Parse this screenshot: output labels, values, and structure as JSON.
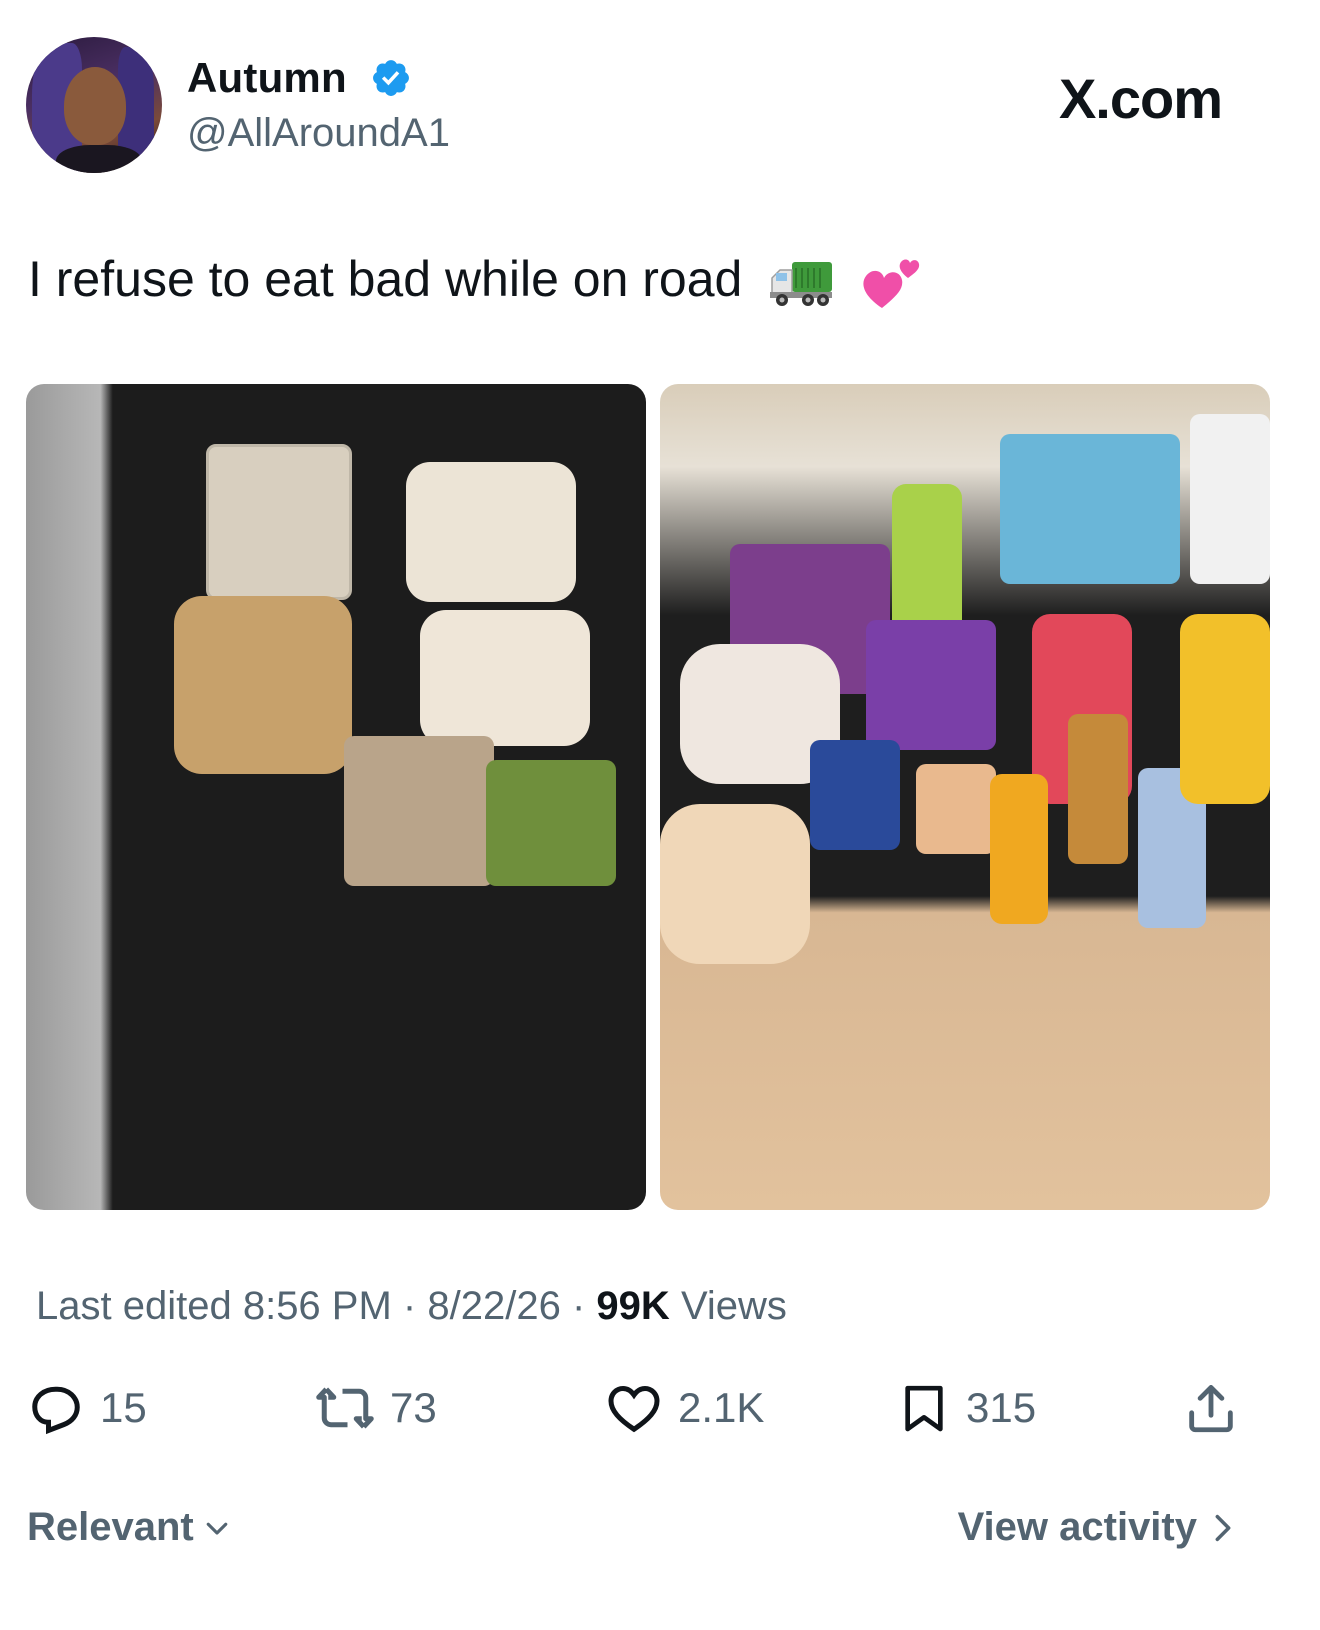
{
  "author": {
    "display_name": "Autumn",
    "handle": "@AllAroundA1",
    "verified": true
  },
  "brand": "X.com",
  "post": {
    "text": "I refuse to eat bad while on road",
    "emojis": [
      "delivery-truck-emoji",
      "revolving-hearts-emoji"
    ]
  },
  "media": [
    {
      "description": "groceries-on-checkout-belt"
    },
    {
      "description": "drinks-and-snacks-on-counter"
    }
  ],
  "meta": {
    "edited_label": "Last edited",
    "time": "8:56 PM",
    "separator": "·",
    "date": "8/22/26",
    "views_count": "99K",
    "views_label": "Views"
  },
  "actions": {
    "replies": "15",
    "reposts": "73",
    "likes": "2.1K",
    "bookmarks": "315"
  },
  "footer": {
    "sort_label": "Relevant",
    "activity_label": "View activity"
  },
  "colors": {
    "verified": "#1d9bf0",
    "secondary_text": "#536471",
    "primary_text": "#0f1419"
  }
}
